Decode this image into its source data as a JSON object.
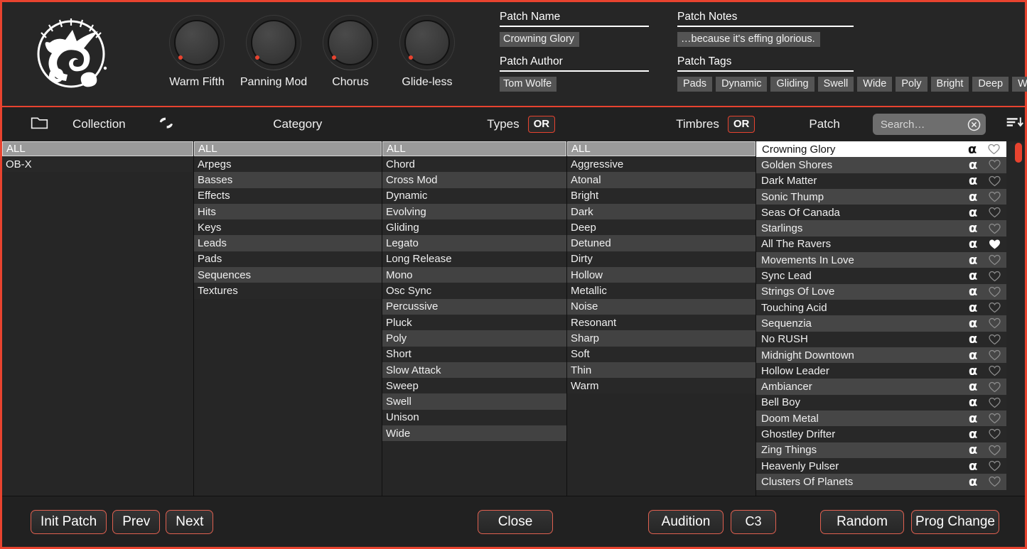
{
  "header": {
    "logo_icon": "synth-brand-logo",
    "knobs": [
      {
        "label": "Warm Fifth"
      },
      {
        "label": "Panning Mod"
      },
      {
        "label": "Chorus"
      },
      {
        "label": "Glide-less"
      }
    ],
    "patch_name_label": "Patch Name",
    "patch_name_value": "Crowning Glory",
    "patch_author_label": "Patch Author",
    "patch_author_value": "Tom Wolfe",
    "patch_notes_label": "Patch Notes",
    "patch_notes_value": "…because it's effing glorious.",
    "patch_tags_label": "Patch Tags",
    "patch_tags": [
      "Pads",
      "Dynamic",
      "Gliding",
      "Swell",
      "Wide",
      "Poly",
      "Bright",
      "Deep",
      "Warm"
    ]
  },
  "toolbar": {
    "folder_icon": "folder-icon",
    "collection_label": "Collection",
    "swap_icon": "swap-refresh-icon",
    "category_label": "Category",
    "types_label": "Types",
    "types_logic": "OR",
    "timbres_label": "Timbres",
    "timbres_logic": "OR",
    "patch_label": "Patch",
    "search_placeholder": "Search…",
    "search_value": "",
    "clear_icon": "clear-circle-icon",
    "sort_icon": "sort-descending-icon"
  },
  "columns": {
    "all_label": "ALL",
    "collection": [
      "OB-X"
    ],
    "category": [
      "Arpegs",
      "Basses",
      "Effects",
      "Hits",
      "Keys",
      "Leads",
      "Pads",
      "Sequences",
      "Textures"
    ],
    "types": [
      "Chord",
      "Cross Mod",
      "Dynamic",
      "Evolving",
      "Gliding",
      "Legato",
      "Long Release",
      "Mono",
      "Osc Sync",
      "Percussive",
      "Pluck",
      "Poly",
      "Short",
      "Slow Attack",
      "Sweep",
      "Swell",
      "Unison",
      "Wide"
    ],
    "timbres": [
      "Aggressive",
      "Atonal",
      "Bright",
      "Dark",
      "Deep",
      "Detuned",
      "Dirty",
      "Hollow",
      "Metallic",
      "Noise",
      "Resonant",
      "Sharp",
      "Soft",
      "Thin",
      "Warm"
    ]
  },
  "patches": [
    {
      "name": "Crowning Glory",
      "badge": "α",
      "favorite": false,
      "selected": true
    },
    {
      "name": "Golden Shores",
      "badge": "α",
      "favorite": false,
      "selected": false
    },
    {
      "name": "Dark Matter",
      "badge": "α",
      "favorite": false,
      "selected": false
    },
    {
      "name": "Sonic Thump",
      "badge": "α",
      "favorite": false,
      "selected": false
    },
    {
      "name": "Seas Of Canada",
      "badge": "α",
      "favorite": false,
      "selected": false
    },
    {
      "name": "Starlings",
      "badge": "α",
      "favorite": false,
      "selected": false
    },
    {
      "name": "All The Ravers",
      "badge": "α",
      "favorite": true,
      "selected": false
    },
    {
      "name": "Movements In Love",
      "badge": "α",
      "favorite": false,
      "selected": false
    },
    {
      "name": "Sync Lead",
      "badge": "α",
      "favorite": false,
      "selected": false
    },
    {
      "name": "Strings Of Love",
      "badge": "α",
      "favorite": false,
      "selected": false
    },
    {
      "name": "Touching Acid",
      "badge": "α",
      "favorite": false,
      "selected": false
    },
    {
      "name": "Sequenzia",
      "badge": "α",
      "favorite": false,
      "selected": false
    },
    {
      "name": "No RUSH",
      "badge": "α",
      "favorite": false,
      "selected": false
    },
    {
      "name": "Midnight Downtown",
      "badge": "α",
      "favorite": false,
      "selected": false
    },
    {
      "name": "Hollow Leader",
      "badge": "α",
      "favorite": false,
      "selected": false
    },
    {
      "name": "Ambiancer",
      "badge": "α",
      "favorite": false,
      "selected": false
    },
    {
      "name": "Bell Boy",
      "badge": "α",
      "favorite": false,
      "selected": false
    },
    {
      "name": "Doom Metal",
      "badge": "α",
      "favorite": false,
      "selected": false
    },
    {
      "name": "Ghostley Drifter",
      "badge": "α",
      "favorite": false,
      "selected": false
    },
    {
      "name": "Zing Things",
      "badge": "α",
      "favorite": false,
      "selected": false
    },
    {
      "name": "Heavenly Pulser",
      "badge": "α",
      "favorite": false,
      "selected": false
    },
    {
      "name": "Clusters Of Planets",
      "badge": "α",
      "favorite": false,
      "selected": false
    }
  ],
  "footer": {
    "init_patch": "Init Patch",
    "prev": "Prev",
    "next": "Next",
    "close": "Close",
    "audition": "Audition",
    "audition_note": "C3",
    "random": "Random",
    "prog_change": "Prog Change"
  },
  "colors": {
    "accent": "#e8432f",
    "panel": "#262626",
    "row_dark": "#282828",
    "row_light": "#464646",
    "header_row": "#9a9a9a"
  }
}
